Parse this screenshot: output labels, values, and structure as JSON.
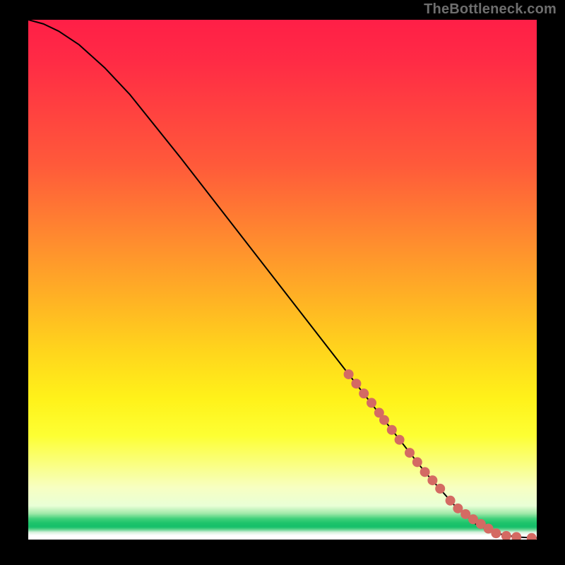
{
  "watermark": "TheBottleneck.com",
  "chart_data": {
    "type": "line",
    "title": "",
    "xlabel": "",
    "ylabel": "",
    "xlim": [
      0,
      100
    ],
    "ylim": [
      0,
      100
    ],
    "grid": false,
    "legend": false,
    "series": [
      {
        "name": "curve",
        "color": "#000000",
        "x": [
          0,
          3,
          6,
          10,
          15,
          20,
          30,
          40,
          50,
          60,
          70,
          78,
          84,
          88,
          92,
          96,
          100
        ],
        "y": [
          100,
          99.2,
          97.8,
          95.2,
          90.8,
          85.6,
          73.4,
          60.8,
          48.2,
          35.6,
          23.0,
          13.0,
          6.4,
          3.0,
          1.2,
          0.5,
          0.3
        ]
      }
    ],
    "highlight_points": {
      "name": "tail-markers",
      "color": "#d46a63",
      "radius_px": 7,
      "x": [
        63,
        64.5,
        66,
        67.5,
        69,
        70,
        71.5,
        73,
        75,
        76.5,
        78,
        79.5,
        81,
        83,
        84.5,
        86,
        87.5,
        89,
        90.5,
        92,
        94,
        96,
        99
      ],
      "y": [
        31.8,
        30.0,
        28.1,
        26.3,
        24.4,
        23.0,
        21.1,
        19.2,
        16.7,
        14.9,
        13.0,
        11.4,
        9.8,
        7.5,
        6.0,
        4.9,
        3.9,
        3.0,
        2.1,
        1.2,
        0.7,
        0.5,
        0.3
      ]
    }
  }
}
